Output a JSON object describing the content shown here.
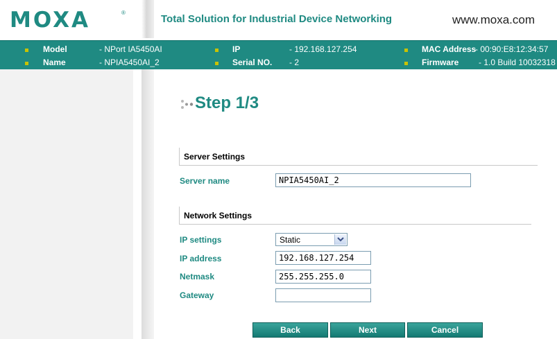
{
  "header": {
    "logo_text": "MOXA",
    "logo_mark": "®",
    "tagline": "Total Solution for Industrial Device Networking",
    "website": "www.moxa.com"
  },
  "info_bar": {
    "model_label": "Model",
    "model_value": "- NPort IA5450AI",
    "name_label": "Name",
    "name_value": "- NPIA5450AI_2",
    "ip_label": "IP",
    "ip_value": "- 192.168.127.254",
    "serial_label": "Serial NO.",
    "serial_value": "- 2",
    "mac_label": "MAC Address",
    "mac_value": "- 00:90:E8:12:34:57",
    "firmware_label": "Firmware",
    "firmware_value": "- 1.0 Build 10032318"
  },
  "step": {
    "title": "Step 1/3"
  },
  "server_settings": {
    "heading": "Server Settings",
    "server_name_label": "Server name",
    "server_name_value": "NPIA5450AI_2"
  },
  "network_settings": {
    "heading": "Network Settings",
    "ip_settings_label": "IP settings",
    "ip_settings_value": "Static",
    "ip_address_label": "IP address",
    "ip_address_value": "192.168.127.254",
    "netmask_label": "Netmask",
    "netmask_value": "255.255.255.0",
    "gateway_label": "Gateway",
    "gateway_value": ""
  },
  "buttons": {
    "back": "Back",
    "next": "Next",
    "cancel": "Cancel"
  },
  "colors": {
    "brand_teal": "#1f8a82",
    "bullet_yellow": "#c8c200"
  }
}
